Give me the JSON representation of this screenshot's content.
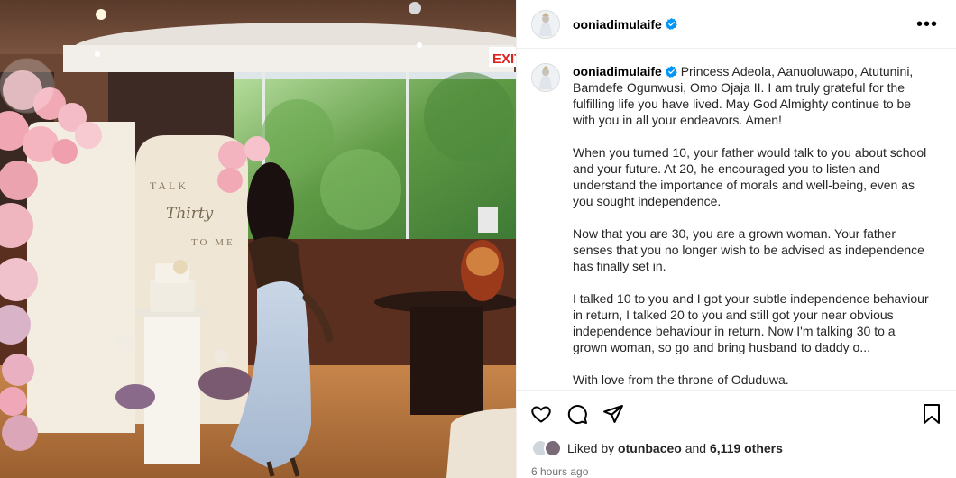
{
  "post": {
    "username": "ooniadimulaife",
    "more_icon": "more-horizontal-icon",
    "verified_icon": "verified-badge-icon",
    "photo_description_text": {
      "sign_line1": "TALK",
      "sign_line2": "Thirty",
      "sign_line3": "TO ME",
      "exit_sign": "EXIT"
    },
    "caption": {
      "paragraph_1": "Princess Adeola, Aanuoluwapo, Atutunini, Bamdefe Ogunwusi, Omo Ojaja II. I am truly grateful for the fulfilling life you have lived. May God Almighty continue to be with you in all your endeavors. Amen!",
      "paragraph_2": "When you turned 10, your father would talk to you about school and your future. At 20, he encouraged you to listen and understand the importance of morals and well-being, even as you sought independence.",
      "paragraph_3": "Now that you are 30, you are a grown woman. Your father senses that you no longer wish to be advised as independence has finally set in.",
      "paragraph_4": "I talked 10 to you and I got your subtle independence behaviour in return, I talked 20 to you and still got your near obvious independence behaviour in return. Now I'm talking 30 to a grown woman, so go and bring husband to daddy o...",
      "paragraph_5": "With love from the throne of Oduduwa."
    },
    "actions": {
      "like_icon": "heart-icon",
      "comment_icon": "comment-icon",
      "share_icon": "send-icon",
      "save_icon": "bookmark-icon"
    },
    "likes": {
      "prefix": "Liked by",
      "liker": "otunbaceo",
      "connector": "and",
      "others": "6,119 others"
    },
    "timestamp": "6 hours ago"
  },
  "colors": {
    "verified": "#0095f6",
    "text": "#262626",
    "muted": "#737373",
    "border": "#efefef"
  }
}
